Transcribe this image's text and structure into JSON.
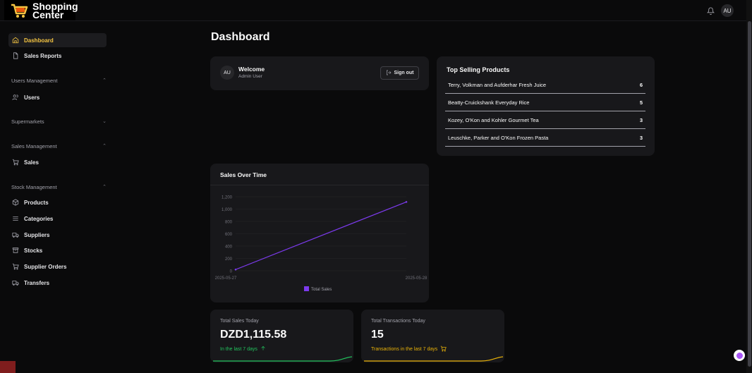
{
  "app": {
    "logo_line1": "Shopping",
    "logo_line2": "Center",
    "user_initials": "AU"
  },
  "sidebar": {
    "items": [
      {
        "label": "Dashboard",
        "icon": "home-icon",
        "active": true
      },
      {
        "label": "Sales Reports",
        "icon": "file-icon"
      }
    ],
    "groups": [
      {
        "label": "Users Management",
        "chevron": "up",
        "items": [
          {
            "label": "Users",
            "icon": "users-icon"
          }
        ]
      },
      {
        "label": "Supermarkets",
        "chevron": "down",
        "items": []
      },
      {
        "label": "Sales Management",
        "chevron": "up",
        "items": [
          {
            "label": "Sales",
            "icon": "cart-icon"
          }
        ]
      },
      {
        "label": "Stock Management",
        "chevron": "up",
        "items": [
          {
            "label": "Products",
            "icon": "box-icon"
          },
          {
            "label": "Categories",
            "icon": "list-icon"
          },
          {
            "label": "Suppliers",
            "icon": "truck-icon"
          },
          {
            "label": "Stocks",
            "icon": "archive-icon"
          },
          {
            "label": "Supplier Orders",
            "icon": "cart-icon"
          },
          {
            "label": "Transfers",
            "icon": "truck-icon"
          }
        ]
      }
    ]
  },
  "main": {
    "title": "Dashboard",
    "welcome": {
      "initials": "AU",
      "title": "Welcome",
      "subtitle": "Admin User",
      "signout_label": "Sign out"
    },
    "top_products": {
      "title": "Top Selling Products",
      "rows": [
        {
          "name": "Terry, Volkman and Aufderhar Fresh Juice",
          "count": "6"
        },
        {
          "name": "Beatty-Cruickshank Everyday Rice",
          "count": "5"
        },
        {
          "name": "Kozey, O'Kon and Kohler Gourmet Tea",
          "count": "3"
        },
        {
          "name": "Leuschke, Parker and O'Kon Frozen Pasta",
          "count": "3"
        }
      ]
    },
    "sales_chart_title": "Sales Over Time",
    "stats": [
      {
        "label": "Total Sales Today",
        "value": "DZD1,115.58",
        "foot": "In the last 7 days",
        "foot_icon": "arrow-up-icon",
        "color": "#22c55e"
      },
      {
        "label": "Total Transactions Today",
        "value": "15",
        "foot": "Transactions in the last 7 days",
        "foot_icon": "cart-icon",
        "color": "#eab308"
      }
    ]
  },
  "colors": {
    "accent": "#f5c542",
    "line": "#7c3aed",
    "green": "#22c55e",
    "yellow": "#eab308"
  },
  "chart_data": {
    "type": "line",
    "title": "Sales Over Time",
    "x": [
      "2025-05-27",
      "2025-05-28"
    ],
    "series": [
      {
        "name": "Total Sales",
        "values": [
          20,
          1115.58
        ]
      }
    ],
    "ylim": [
      0,
      1200
    ],
    "yticks": [
      0,
      200,
      400,
      600,
      800,
      1000,
      1200
    ],
    "ytick_labels": [
      "0",
      "200",
      "400",
      "600",
      "800",
      "1,000",
      "1,200"
    ],
    "grid": true,
    "legend": "bottom"
  }
}
